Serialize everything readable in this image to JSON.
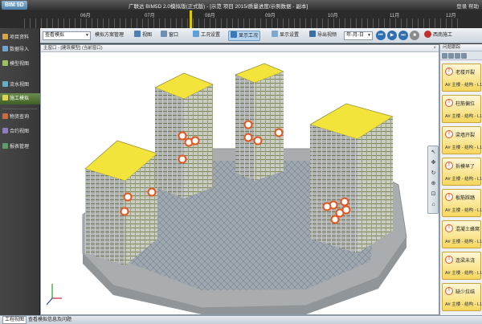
{
  "window": {
    "logo": "BIM 5D",
    "title": "广联达 BIM5D 2.0模拟版(正式版) - [示范 项目 2015/质量进度/示例数据 - 副本]",
    "right_text": "登录 帮助"
  },
  "timeline": {
    "months": [
      "06月",
      "07月",
      "08月",
      "09月",
      "10月",
      "11月",
      "12月"
    ]
  },
  "toolbar": {
    "mode_select": "查看模拟",
    "plan_manage": "模拟方案管理",
    "view_label": "视图",
    "window_label": "窗口",
    "work_setting": "工况设置",
    "show_work": "显示工况",
    "display_setting": "显示设置",
    "export_video": "导出视频",
    "date_format": "年-月-日",
    "brand": "西南施工"
  },
  "sidebar": {
    "items": [
      {
        "label": "项目资料",
        "icon": "folder-icon"
      },
      {
        "label": "数据导入",
        "icon": "import-icon"
      },
      {
        "label": "模型视图",
        "icon": "model-icon"
      },
      {
        "label": "流水视图",
        "icon": "flow-icon"
      },
      {
        "label": "施工模拟",
        "icon": "simulation-icon",
        "active": true
      },
      {
        "label": "物资查询",
        "icon": "material-icon"
      },
      {
        "label": "合约视图",
        "icon": "contract-icon"
      },
      {
        "label": "报表管理",
        "icon": "report-icon"
      }
    ]
  },
  "viewport": {
    "title": "主窗口 - [建筑模型] (当前窗口)"
  },
  "right_panel": {
    "title": "问题跟踪",
    "issues": [
      {
        "title": "老楼开裂",
        "sub": "A# 主楼 - 结构 - L1"
      },
      {
        "title": "柱筋偏位",
        "sub": "A# 主楼 - 结构 - L1"
      },
      {
        "title": "梁墙开裂",
        "sub": "A# 主楼 - 结构 - L1"
      },
      {
        "title": "拆模早了",
        "sub": "A# 主楼 - 结构 - L1"
      },
      {
        "title": "板筋踩踏",
        "sub": "A# 主楼 - 结构 - L1"
      },
      {
        "title": "混凝土蜂窝",
        "sub": "A# 主楼 - 结构 - L1"
      },
      {
        "title": "连梁未浇",
        "sub": "A# 主楼 - 结构 - L1"
      },
      {
        "title": "缺少拉结",
        "sub": "A# 主楼 - 结构 - L1"
      }
    ]
  },
  "statusbar": {
    "tab": "工程视图",
    "text": "查看模拟信息及问题"
  },
  "colors": {
    "issue_marker": "#e2561f",
    "roof_yellow": "#f2e43a",
    "building_gray": "#b8bcbd",
    "sidebar_active": "#5a7a3a"
  }
}
